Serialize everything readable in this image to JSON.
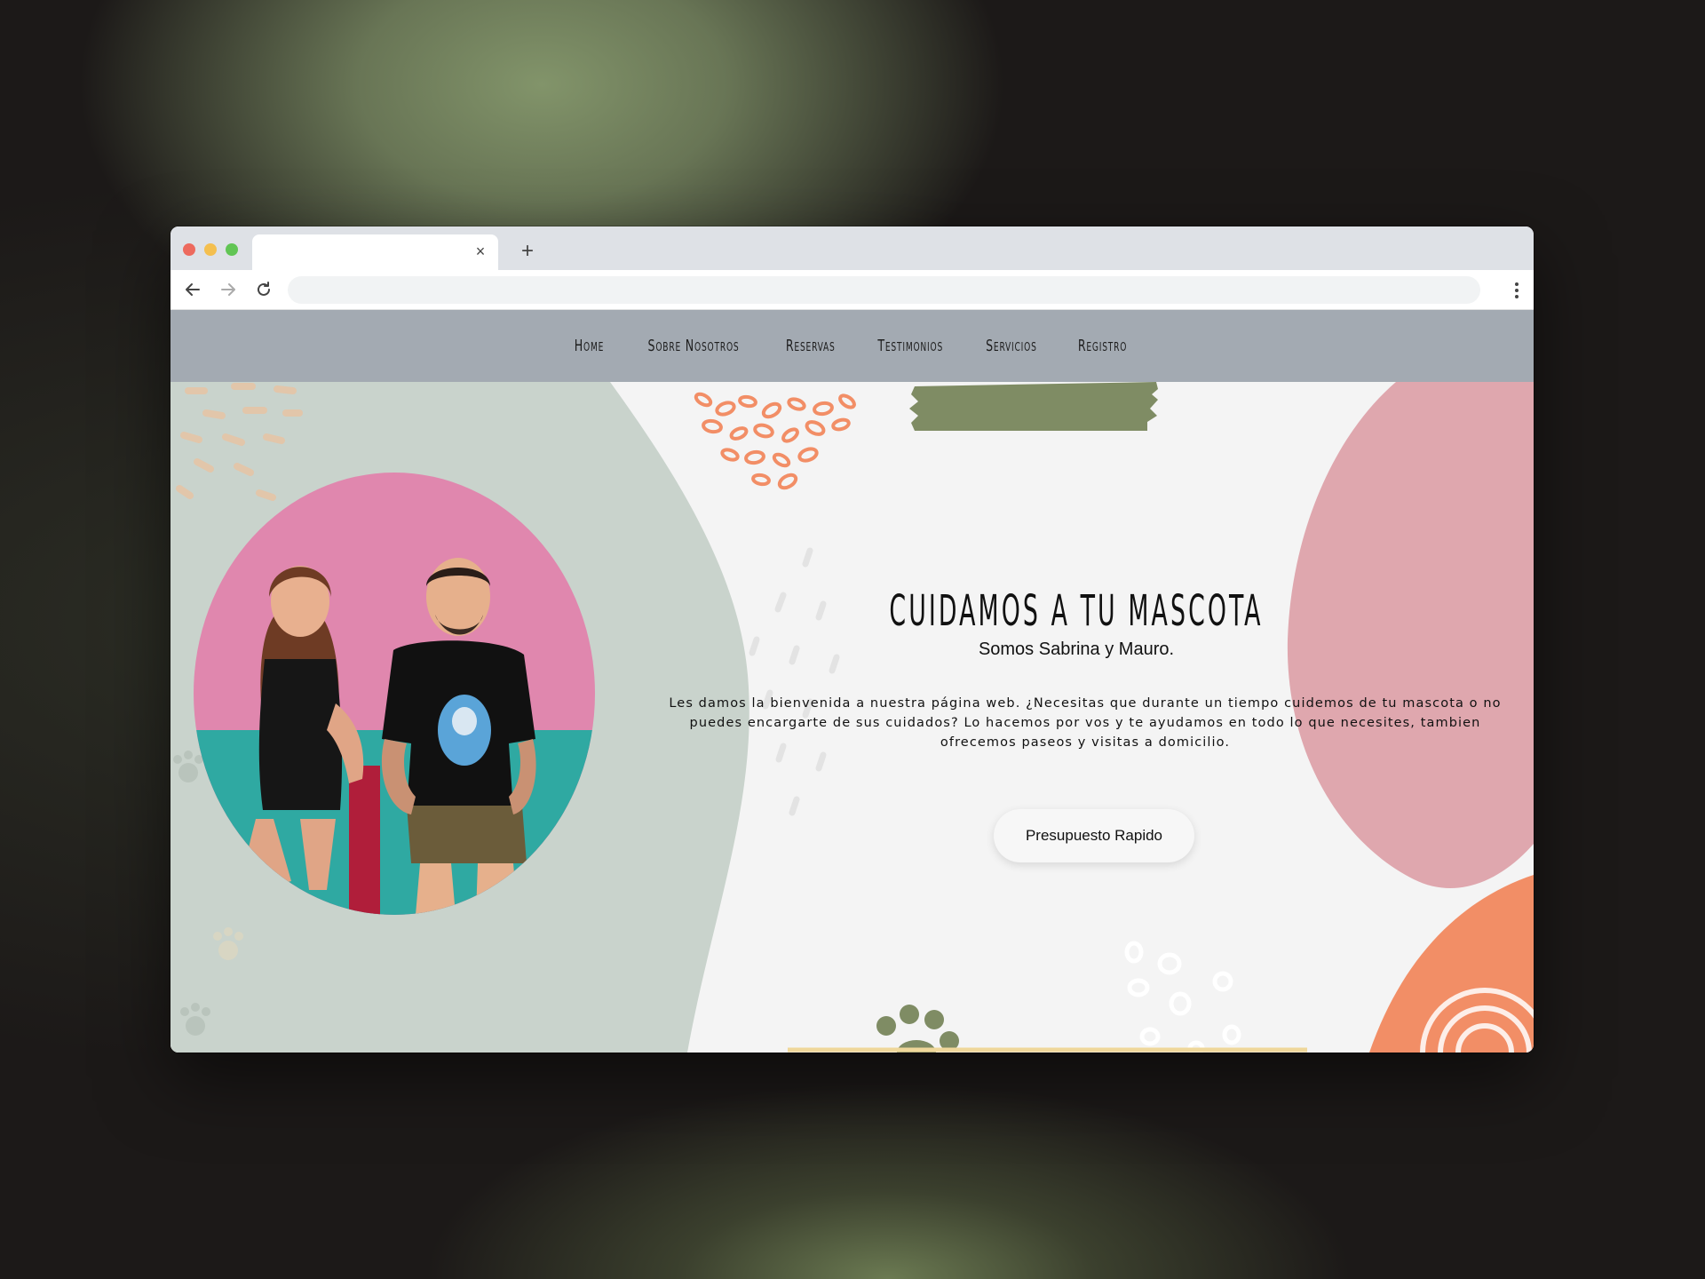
{
  "browser": {
    "tab_title": "",
    "url": ""
  },
  "nav": {
    "items": [
      "Home",
      "Sobre Nosotros",
      "Reservas",
      "Testimonios",
      "Servicios",
      "Registro"
    ]
  },
  "hero": {
    "title": "CUIDAMOS A TU MASCOTA",
    "subtitle": "Somos Sabrina y Mauro.",
    "body": "Les damos la bienvenida a nuestra página web. ¿Necesitas que durante un tiempo cuidemos de tu mascota o no puedes encargarte de sus cuidados? Lo hacemos por vos y te ayudamos en todo lo que necesites, tambien ofrecemos paseos y visitas a domicilio.",
    "cta_label": "Presupuesto Rapido"
  },
  "colors": {
    "nav_bg": "#a3aab2",
    "sage": "#c9d3cc",
    "pink": "#dfa7ae",
    "orange": "#f28e66",
    "green": "#7f8c64",
    "photo_bg": "#e087ae"
  }
}
